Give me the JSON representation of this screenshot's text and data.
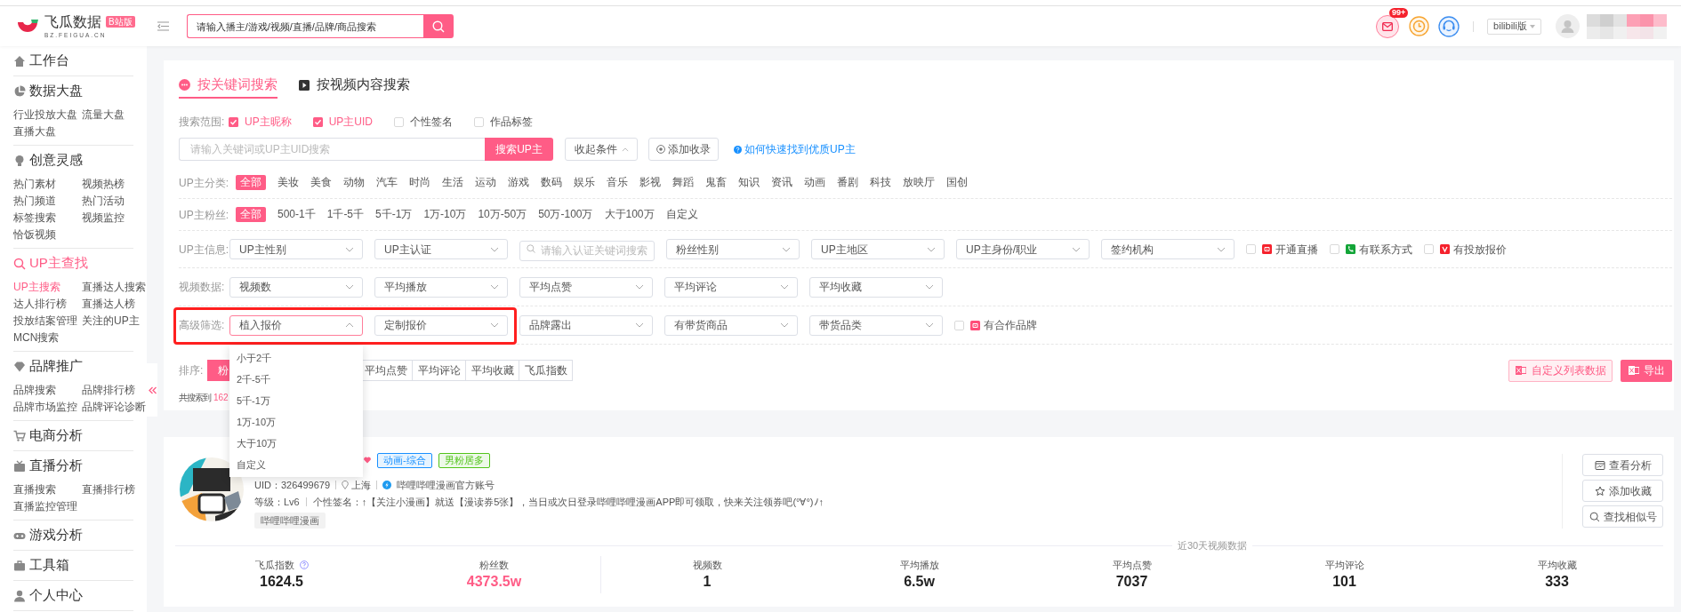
{
  "header": {
    "logo": {
      "name": "飞瓜数据",
      "badge": "B站版",
      "domain": "BZ.FEIGUA.CN"
    },
    "search": {
      "placeholder": "请输入播主/游戏/视频/直播/品牌/商品搜索"
    },
    "message_badge": "99+",
    "version": "bilibili版"
  },
  "sidebar": {
    "sections": [
      {
        "title": "工作台",
        "selected": false
      },
      {
        "title": "数据大盘",
        "selected": false,
        "items": [
          {
            "label": "行业投放大盘",
            "selected": false
          },
          {
            "label": "流量大盘",
            "selected": false
          },
          {
            "label": "直播大盘",
            "selected": false
          }
        ]
      },
      {
        "title": "创意灵感",
        "selected": false,
        "items": [
          {
            "label": "热门素材",
            "selected": false
          },
          {
            "label": "视频热榜",
            "selected": false
          },
          {
            "label": "热门频道",
            "selected": false
          },
          {
            "label": "热门活动",
            "selected": false
          },
          {
            "label": "标签搜索",
            "selected": false
          },
          {
            "label": "视频监控",
            "selected": false
          },
          {
            "label": "恰饭视频",
            "selected": false
          }
        ]
      },
      {
        "title": "UP主查找",
        "selected": true,
        "items": [
          {
            "label": "UP主搜索",
            "selected": true
          },
          {
            "label": "直播达人搜索",
            "selected": false
          },
          {
            "label": "达人排行榜",
            "selected": false
          },
          {
            "label": "直播达人榜",
            "selected": false
          },
          {
            "label": "投放结案管理",
            "selected": false
          },
          {
            "label": "关注的UP主",
            "selected": false
          },
          {
            "label": "MCN搜索",
            "selected": false
          }
        ]
      },
      {
        "title": "品牌推广",
        "selected": false,
        "items": [
          {
            "label": "品牌搜索",
            "selected": false
          },
          {
            "label": "品牌排行榜",
            "selected": false
          },
          {
            "label": "品牌市场监控",
            "selected": false
          },
          {
            "label": "品牌评论诊断",
            "selected": false
          }
        ]
      },
      {
        "title": "电商分析",
        "selected": false
      },
      {
        "title": "直播分析",
        "selected": false,
        "items": [
          {
            "label": "直播搜索",
            "selected": false
          },
          {
            "label": "直播排行榜",
            "selected": false
          },
          {
            "label": "直播监控管理",
            "selected": false
          }
        ]
      },
      {
        "title": "游戏分析",
        "selected": false
      },
      {
        "title": "工具箱",
        "selected": false
      },
      {
        "title": "个人中心",
        "selected": false
      }
    ]
  },
  "search_panel": {
    "tabs": [
      {
        "label": "按关键词搜索",
        "selected": true
      },
      {
        "label": "按视频内容搜索",
        "selected": false
      }
    ],
    "scope": {
      "label": "搜索范围:",
      "options": [
        {
          "label": "UP主昵称",
          "checked": true
        },
        {
          "label": "UP主UID",
          "checked": true
        },
        {
          "label": "个性签名",
          "checked": false
        },
        {
          "label": "作品标签",
          "checked": false
        }
      ]
    },
    "keyword": {
      "placeholder": "请输入关键词或UP主UID搜索",
      "button": "搜索UP主"
    },
    "collapse_button": "收起条件",
    "add_button": "添加收录",
    "help_link": "如何快速找到优质UP主",
    "filter_rows": [
      {
        "kind": "chips",
        "label": "UP主分类:",
        "options": [
          {
            "label": "全部",
            "selected": true
          },
          {
            "label": "美妆",
            "selected": false
          },
          {
            "label": "美食",
            "selected": false
          },
          {
            "label": "动物",
            "selected": false
          },
          {
            "label": "汽车",
            "selected": false
          },
          {
            "label": "时尚",
            "selected": false
          },
          {
            "label": "生活",
            "selected": false
          },
          {
            "label": "运动",
            "selected": false
          },
          {
            "label": "游戏",
            "selected": false
          },
          {
            "label": "数码",
            "selected": false
          },
          {
            "label": "娱乐",
            "selected": false
          },
          {
            "label": "音乐",
            "selected": false
          },
          {
            "label": "影视",
            "selected": false
          },
          {
            "label": "舞蹈",
            "selected": false
          },
          {
            "label": "鬼畜",
            "selected": false
          },
          {
            "label": "知识",
            "selected": false
          },
          {
            "label": "资讯",
            "selected": false
          },
          {
            "label": "动画",
            "selected": false
          },
          {
            "label": "番剧",
            "selected": false
          },
          {
            "label": "科技",
            "selected": false
          },
          {
            "label": "放映厅",
            "selected": false
          },
          {
            "label": "国创",
            "selected": false
          }
        ]
      },
      {
        "kind": "chips",
        "label": "UP主粉丝:",
        "options": [
          {
            "label": "全部",
            "selected": true
          },
          {
            "label": "500-1千",
            "selected": false
          },
          {
            "label": "1千-5千",
            "selected": false
          },
          {
            "label": "5千-1万",
            "selected": false
          },
          {
            "label": "1万-10万",
            "selected": false
          },
          {
            "label": "10万-50万",
            "selected": false
          },
          {
            "label": "50万-100万",
            "selected": false
          },
          {
            "label": "大于100万",
            "selected": false
          },
          {
            "label": "自定义",
            "selected": false
          }
        ]
      },
      {
        "kind": "controls",
        "label": "UP主信息:",
        "highlighted": false,
        "controls": [
          {
            "kind": "select",
            "label": "UP主性别",
            "expanded": false
          },
          {
            "kind": "select",
            "label": "UP主认证",
            "expanded": false
          },
          {
            "kind": "search",
            "placeholder": "请输入认证关键词搜索"
          },
          {
            "kind": "select",
            "label": "粉丝性别",
            "expanded": false
          },
          {
            "kind": "select",
            "label": "UP主地区",
            "expanded": false
          },
          {
            "kind": "select",
            "label": "UP主身份/职业",
            "expanded": false
          },
          {
            "kind": "select",
            "label": "签约机构",
            "expanded": false
          },
          {
            "kind": "checkbox",
            "label": "开通直播",
            "checked": false,
            "color": "#f5222d"
          },
          {
            "kind": "checkbox",
            "label": "有联系方式",
            "checked": false,
            "color": "#13a538"
          },
          {
            "kind": "checkbox",
            "label": "有投放报价",
            "checked": false,
            "color": "#f5222d"
          }
        ]
      },
      {
        "kind": "controls",
        "label": "视频数据:",
        "highlighted": false,
        "controls": [
          {
            "kind": "select",
            "label": "视频数",
            "expanded": false
          },
          {
            "kind": "select",
            "label": "平均播放",
            "expanded": false
          },
          {
            "kind": "select",
            "label": "平均点赞",
            "expanded": false
          },
          {
            "kind": "select",
            "label": "平均评论",
            "expanded": false
          },
          {
            "kind": "select",
            "label": "平均收藏",
            "expanded": false
          }
        ]
      },
      {
        "kind": "controls",
        "label": "高级筛选:",
        "highlighted": true,
        "highlighted_controls": [
          {
            "kind": "select",
            "label": "植入报价",
            "expanded": true,
            "options": [
              "小于2千",
              "2千-5千",
              "5千-1万",
              "1万-10万",
              "大于10万",
              "自定义"
            ]
          },
          {
            "kind": "select",
            "label": "定制报价",
            "expanded": false
          }
        ],
        "controls": [
          {
            "kind": "select",
            "label": "品牌露出",
            "expanded": false
          },
          {
            "kind": "select",
            "label": "有带货商品",
            "expanded": false
          },
          {
            "kind": "select",
            "label": "带货品类",
            "expanded": false
          },
          {
            "kind": "checkbox",
            "label": "有合作品牌",
            "checked": false,
            "color": "#ff4d79"
          }
        ]
      }
    ],
    "sort": {
      "label": "排序:",
      "options": [
        {
          "label": "粉",
          "selected": true
        },
        {
          "label": "平均点赞",
          "selected": false
        },
        {
          "label": "平均评论",
          "selected": false
        },
        {
          "label": "平均收藏",
          "selected": false
        },
        {
          "label": "飞瓜指数",
          "selected": false
        }
      ]
    },
    "custom_columns_button": "自定义列表数据",
    "export_button": "导出",
    "result_count": {
      "label": "共搜索到",
      "value": "162"
    }
  },
  "results": [
    {
      "tags": [
        {
          "label": "动画-综合",
          "color": "#1890ff"
        },
        {
          "label": "男粉居多",
          "color": "#52c41a"
        }
      ],
      "uid": "UID：326499679",
      "location": "上海",
      "verification": "哔哩哔哩漫画官方账号",
      "level": "等级：Lv6",
      "signature": "个性签名：↑【关注小漫画】就送【漫读券5张】，当日或次日登录哔哩哔哩漫画APP即可领取，快来关注领券吧(°∀°)ﾉ↑",
      "label_tag": "哔哩哔哩漫画",
      "actions": [
        "查看分析",
        "添加收藏",
        "查找相似号"
      ],
      "stats_title": "近30天视频数据",
      "stats": [
        {
          "label": "飞瓜指数",
          "value": "1624.5",
          "help": true,
          "emphasized": false
        },
        {
          "label": "粉丝数",
          "value": "4373.5w",
          "help": false,
          "emphasized": true
        },
        {
          "label": "视频数",
          "value": "1",
          "help": false,
          "emphasized": false
        },
        {
          "label": "平均播放",
          "value": "6.5w",
          "help": false,
          "emphasized": false
        },
        {
          "label": "平均点赞",
          "value": "7037",
          "help": false,
          "emphasized": false
        },
        {
          "label": "平均评论",
          "value": "101",
          "help": false,
          "emphasized": false
        },
        {
          "label": "平均收藏",
          "value": "333",
          "help": false,
          "emphasized": false
        }
      ]
    }
  ]
}
